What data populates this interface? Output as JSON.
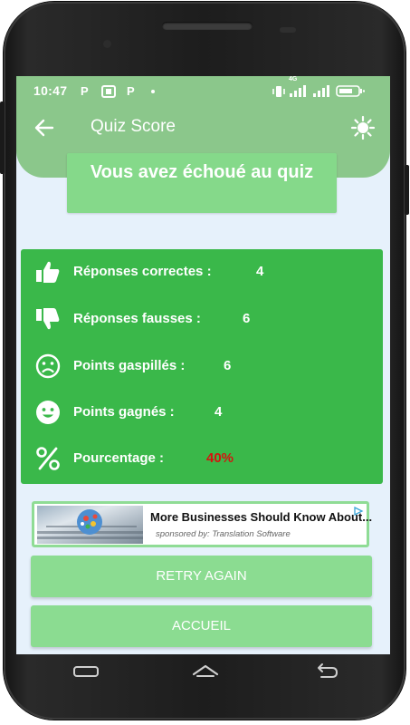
{
  "statusbar": {
    "time": "10:47",
    "icons": [
      "parking-icon",
      "app-icon",
      "parking-icon",
      "dot"
    ],
    "right_icons": [
      "vibrate-icon",
      "signal-4g-icon",
      "signal-icon",
      "battery-icon"
    ],
    "network_label": "4G"
  },
  "appbar": {
    "title": "Quiz Score",
    "back_icon": "arrow-left-icon",
    "theme_icon": "brightness-icon"
  },
  "result": {
    "message": "Vous avez échoué au quiz"
  },
  "stats": [
    {
      "icon": "thumbs-up-icon",
      "label": "Réponses correctes :",
      "value": "4"
    },
    {
      "icon": "thumbs-down-icon",
      "label": "Réponses fausses :",
      "value": "6"
    },
    {
      "icon": "sad-face-icon",
      "label": "Points gaspillés :",
      "value": "6"
    },
    {
      "icon": "smile-face-icon",
      "label": "Points gagnés :",
      "value": "4"
    },
    {
      "icon": "percent-icon",
      "label": "Pourcentage :",
      "value": "40%"
    }
  ],
  "ad": {
    "title": "More Businesses Should Know About...",
    "sponsor": "sponsored by: Translation Software"
  },
  "buttons": {
    "retry": "RETRY AGAIN",
    "home": "ACCUEIL"
  },
  "colors": {
    "header": "#8bc78b",
    "stats_panel": "#3ab84a",
    "button": "#8bdc91",
    "percentage_value": "#d3140f",
    "screen_bg": "#e6f1fb"
  }
}
